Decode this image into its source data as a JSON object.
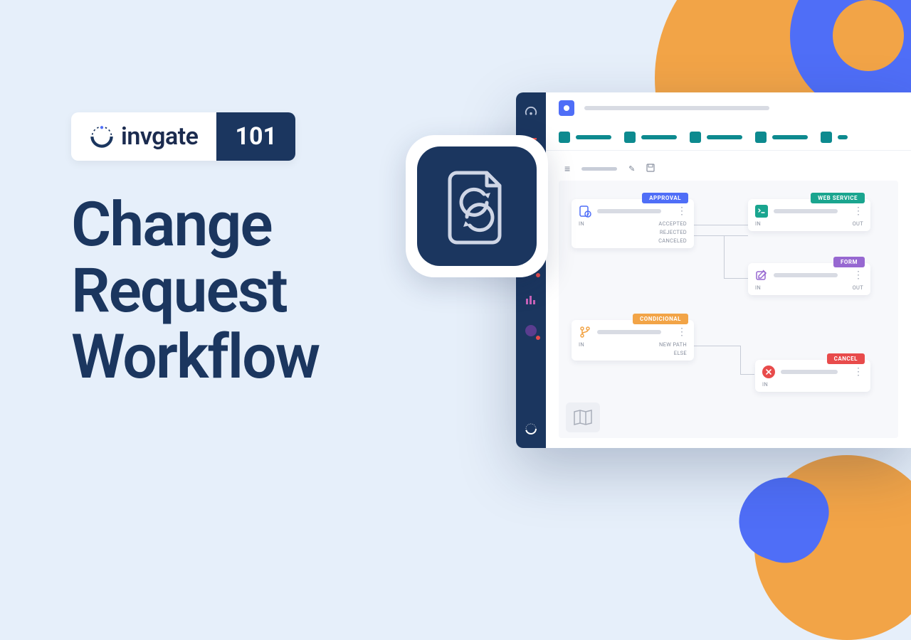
{
  "brand": {
    "name": "invgate",
    "badge_number": "101"
  },
  "title": {
    "line1": "Change",
    "line2": "Request",
    "line3": "Workflow"
  },
  "sidebar": {
    "items": [
      {
        "name": "gauge-icon"
      },
      {
        "name": "list-icon"
      },
      {
        "name": "inbox-icon"
      },
      {
        "name": "alert-icon"
      },
      {
        "name": "flag-icon"
      },
      {
        "name": "money-icon"
      },
      {
        "name": "chart-icon"
      },
      {
        "name": "globe-icon"
      }
    ]
  },
  "canvas_toolbar": {
    "menu": "≡",
    "edit": "✎",
    "save": "🖫"
  },
  "nodes": {
    "approval": {
      "tag": "APPROVAL",
      "tag_color": "#4f6ef7",
      "in": "IN",
      "out1": "ACCEPTED",
      "out2": "REJECTED",
      "out3": "CANCELED"
    },
    "conditional": {
      "tag": "CONDICIONAL",
      "tag_color": "#f2a447",
      "in": "IN",
      "out1": "NEW PATH",
      "out2": "ELSE"
    },
    "webservice": {
      "tag": "WEB SERVICE",
      "tag_color": "#1aa58f",
      "in": "IN",
      "out": "OUT"
    },
    "form": {
      "tag": "FORM",
      "tag_color": "#9768d1",
      "in": "IN",
      "out": "OUT"
    },
    "cancel": {
      "tag": "CANCEL",
      "tag_color": "#e84b4b",
      "in": "IN"
    }
  }
}
